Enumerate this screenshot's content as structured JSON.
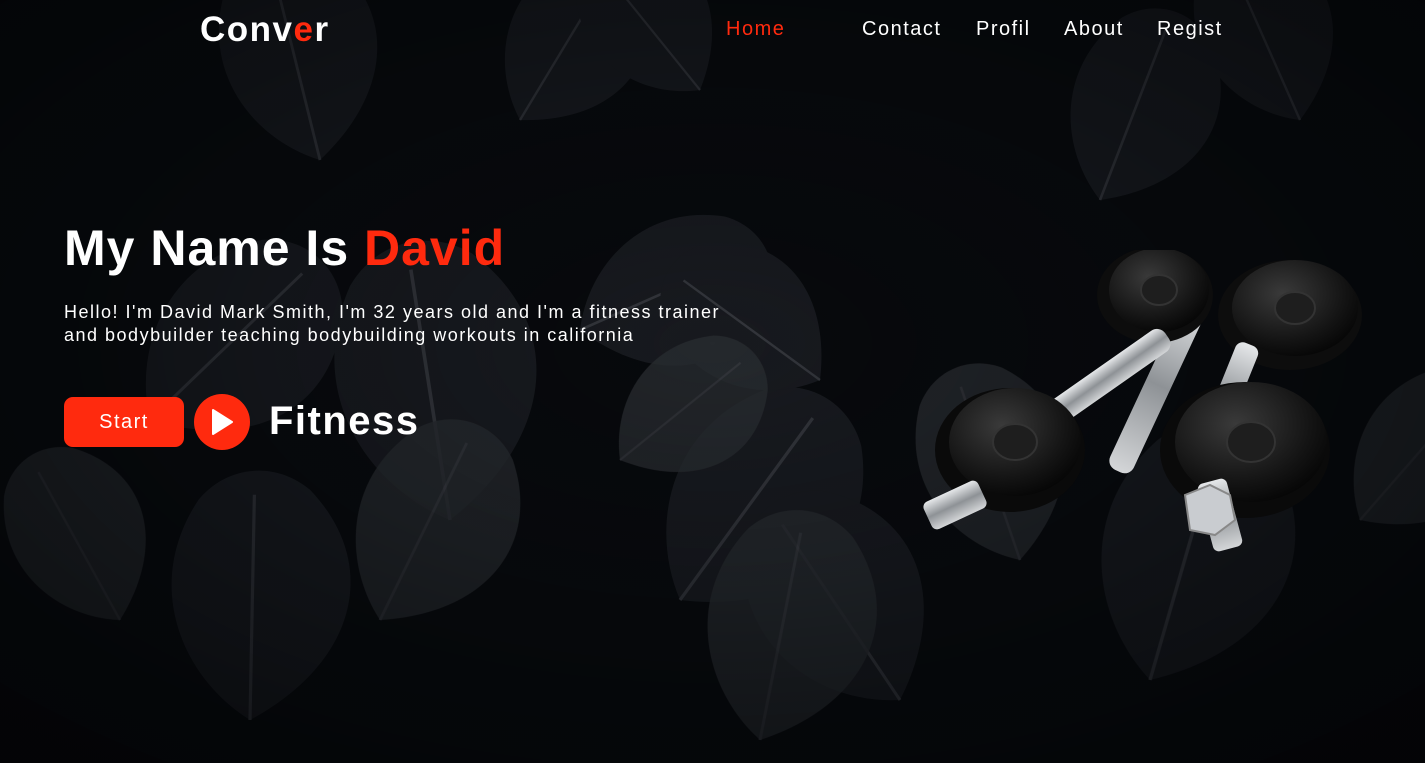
{
  "brand": {
    "logo_a": "Conv",
    "logo_b": "e",
    "logo_c": "r"
  },
  "nav": {
    "home": "Home",
    "contact": "Contact",
    "profil": "Profil",
    "about": "About",
    "regist": "Regist"
  },
  "hero": {
    "title_prefix": "My Name Is ",
    "title_name": "David",
    "bio": "Hello! I'm David Mark Smith, I'm 32 years old and I'm a fitness trainer and bodybuilder teaching bodybuilding workouts in california",
    "start_label": "Start",
    "tagline": "Fitness"
  },
  "icons": {
    "play": "play-icon",
    "background": "monstera-leaves",
    "product": "dumbbells"
  },
  "colors": {
    "accent": "#ff2a0e",
    "background": "#06080b",
    "text": "#ffffff"
  }
}
